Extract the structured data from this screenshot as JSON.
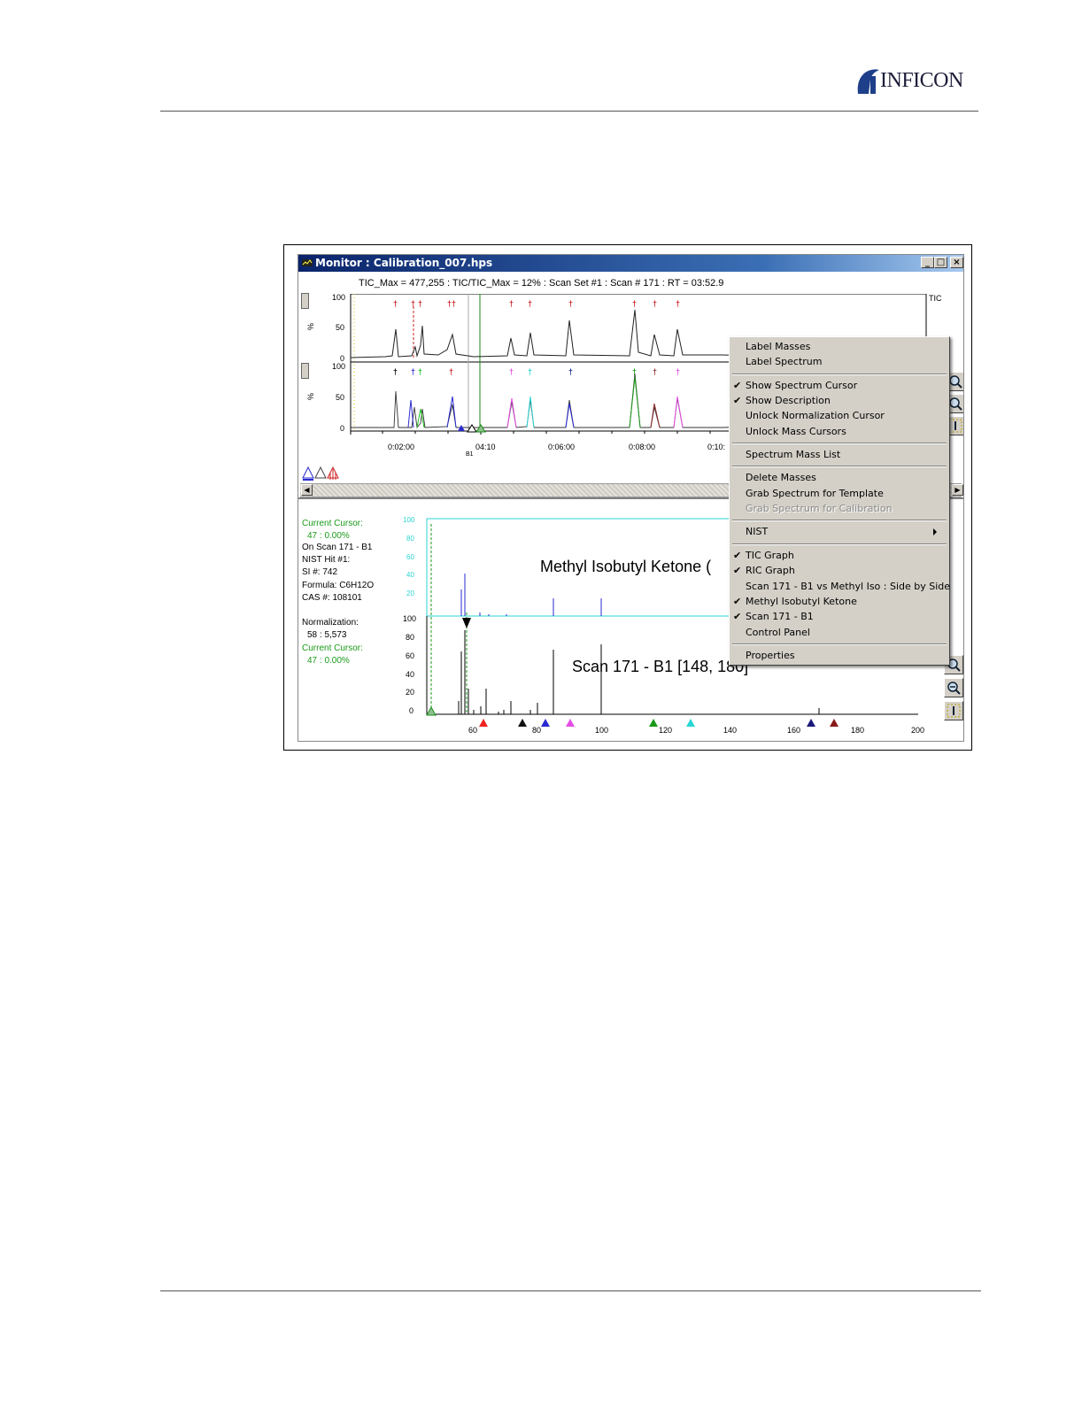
{
  "header": {
    "brand": "INFICON"
  },
  "window": {
    "title": "Monitor : Calibration_007.hps",
    "status_line": "TIC_Max = 477,255 : TIC/TIC_Max = 12% : Scan Set #1 : Scan #    171 : RT = 03:52.9",
    "tic_label": "TIC",
    "pct_label": "%",
    "upper_y_ticks": [
      "100",
      "50",
      "0"
    ],
    "lower_y_ticks": [
      "100",
      "50",
      "0"
    ],
    "time_ticks": [
      "0:02:00",
      "04:10",
      "0:06:00",
      "0:08:00",
      "0:10:"
    ],
    "marker_b1": "B1"
  },
  "info_panel": {
    "cursor_label": "Current Cursor:",
    "cursor_value": "47 : 0.00%",
    "on_scan": "On Scan 171 - B1",
    "nist_hit": "NIST Hit #1:",
    "si": "SI #: 742",
    "formula": "Formula: C6H12O",
    "cas": "CAS #: 108101",
    "norm_label": "Normalization:",
    "norm_value": "58 : 5,573",
    "cursor2_label": "Current Cursor:",
    "cursor2_value": "47 : 0.00%"
  },
  "spectrum": {
    "upper_title": "Methyl Isobutyl Ketone (",
    "lower_title": "Scan 171  - B1 [148, 180]",
    "upper_y_ticks": [
      "100",
      "80",
      "60",
      "40",
      "20"
    ],
    "lower_y_ticks": [
      "100",
      "80",
      "60",
      "40",
      "20",
      "0"
    ],
    "x_ticks": [
      "60",
      "80",
      "100",
      "120",
      "140",
      "160",
      "180",
      "200"
    ]
  },
  "context_menu": {
    "items": [
      {
        "label": "Label Masses",
        "checked": false,
        "disabled": false
      },
      {
        "label": "Label Spectrum",
        "checked": false,
        "disabled": false
      },
      {
        "label": "Show Spectrum Cursor",
        "checked": true,
        "disabled": false
      },
      {
        "label": "Show Description",
        "checked": true,
        "disabled": false
      },
      {
        "label": "Unlock Normalization Cursor",
        "checked": false,
        "disabled": false
      },
      {
        "label": "Unlock Mass Cursors",
        "checked": false,
        "disabled": false
      },
      {
        "label": "Spectrum Mass List",
        "checked": false,
        "disabled": false
      },
      {
        "label": "Delete Masses",
        "checked": false,
        "disabled": false
      },
      {
        "label": "Grab Spectrum for Template",
        "checked": false,
        "disabled": false
      },
      {
        "label": "Grab Spectrum for Calibration",
        "checked": false,
        "disabled": true
      },
      {
        "label": "NIST",
        "checked": false,
        "disabled": false
      },
      {
        "label": "TIC Graph",
        "checked": true,
        "disabled": false
      },
      {
        "label": "RIC Graph",
        "checked": true,
        "disabled": false
      },
      {
        "label": "Scan 171 - B1 vs Methyl Iso :  Side by Side",
        "checked": false,
        "disabled": false
      },
      {
        "label": "Methyl Isobutyl Ketone",
        "checked": true,
        "disabled": false
      },
      {
        "label": "Scan 171 - B1",
        "checked": true,
        "disabled": false
      },
      {
        "label": "Control Panel",
        "checked": false,
        "disabled": false
      },
      {
        "label": "Properties",
        "checked": false,
        "disabled": false
      }
    ],
    "check_glyph": "✔"
  },
  "colors": {
    "titlebar": "#0a246a",
    "menu_bg": "#d4d0c8",
    "cursor_green": "#1a9a1a",
    "spectrum_cyan": "#2bd3d3"
  }
}
